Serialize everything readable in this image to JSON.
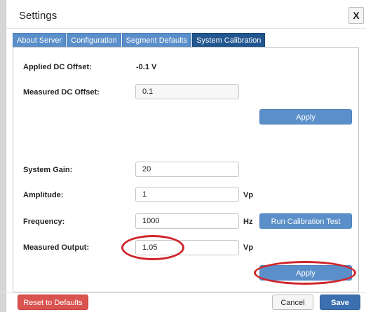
{
  "dialog": {
    "title": "Settings",
    "close_label": "X"
  },
  "tabs": [
    {
      "label": "About Server",
      "active": false
    },
    {
      "label": "Configuration",
      "active": false
    },
    {
      "label": "Segment Defaults",
      "active": false
    },
    {
      "label": "System Calibration",
      "active": true
    }
  ],
  "calibration": {
    "applied_offset_label": "Applied DC Offset:",
    "applied_offset_value": "-0.1 V",
    "measured_offset_label": "Measured DC Offset:",
    "measured_offset_value": "0.1",
    "apply_offset_label": "Apply",
    "system_gain_label": "System Gain:",
    "system_gain_value": "20",
    "amplitude_label": "Amplitude:",
    "amplitude_value": "1",
    "amplitude_unit": "Vp",
    "frequency_label": "Frequency:",
    "frequency_value": "1000",
    "frequency_unit": "Hz",
    "run_test_label": "Run Calibration Test",
    "measured_output_label": "Measured Output:",
    "measured_output_value": "1.05",
    "measured_output_unit": "Vp",
    "apply_output_label": "Apply"
  },
  "footer": {
    "reset_label": "Reset to Defaults",
    "cancel_label": "Cancel",
    "save_label": "Save"
  },
  "colors": {
    "tab": "#5b8fc9",
    "tab_active": "#22568f",
    "primary_button": "#5b8fc9",
    "danger_button": "#d9534f",
    "annotation_ring": "#d0252a"
  }
}
